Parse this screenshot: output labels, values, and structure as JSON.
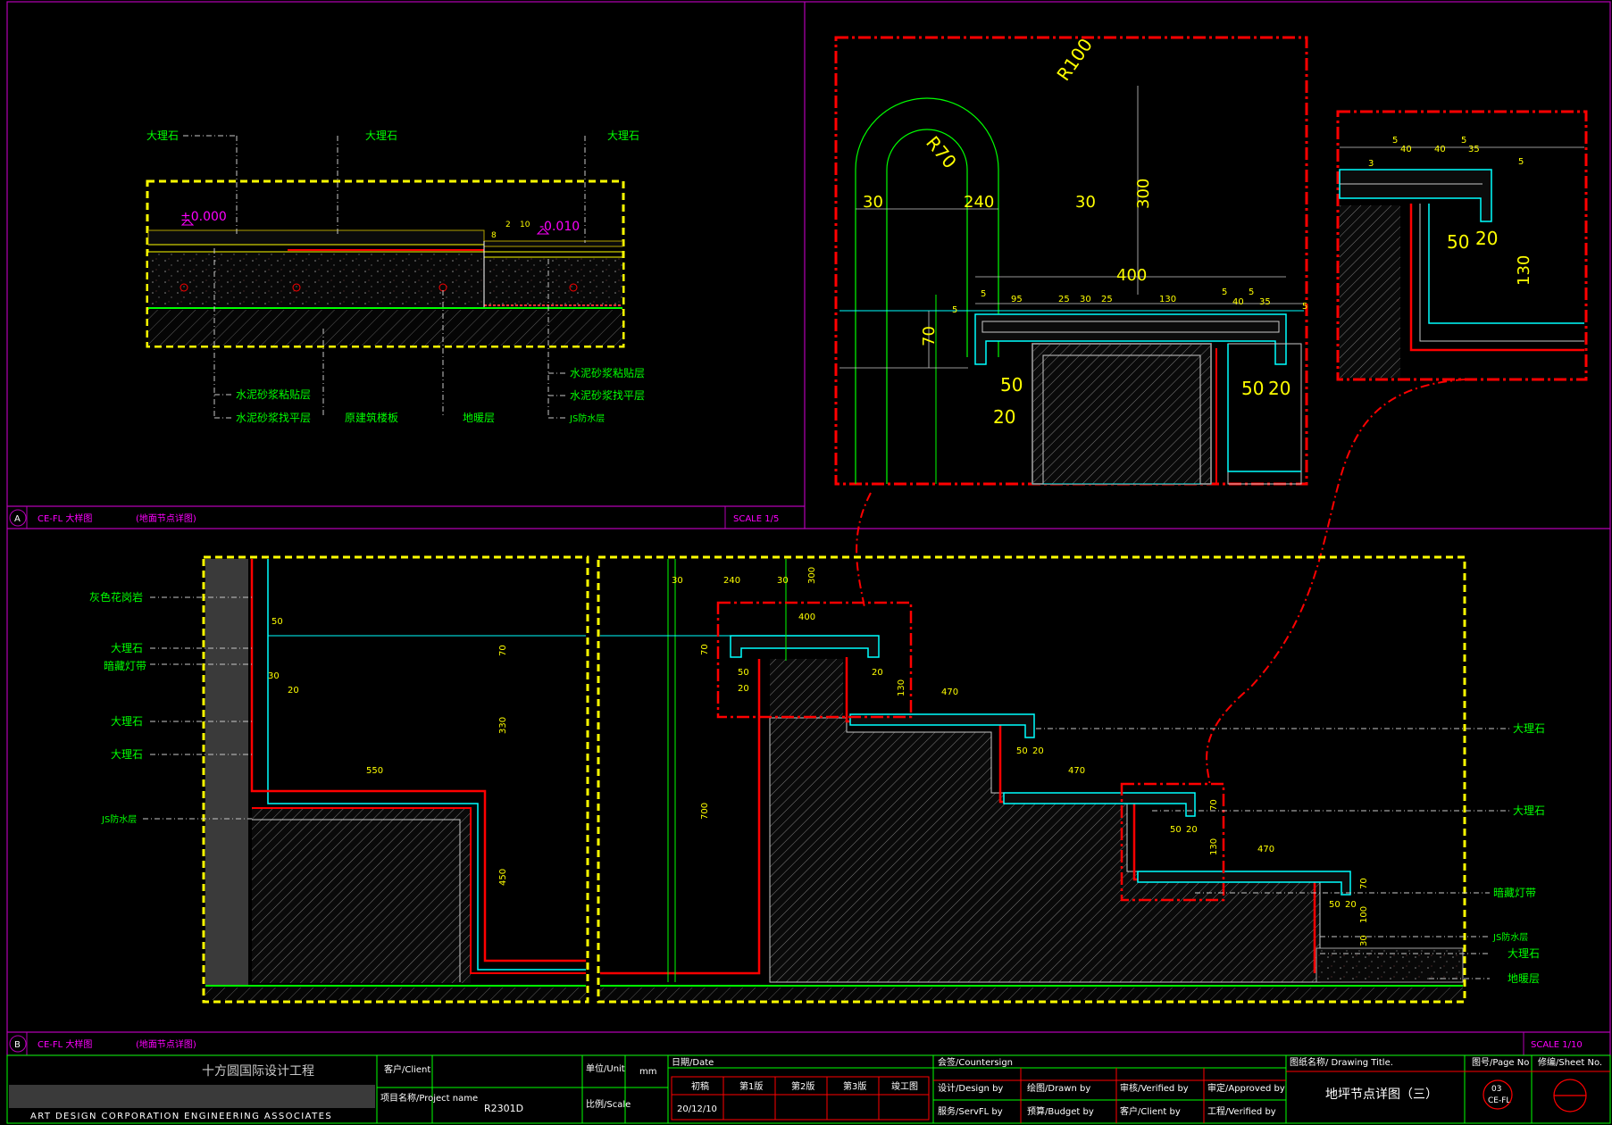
{
  "detail_a": {
    "labels_top": [
      "大理石",
      "大理石",
      "大理石"
    ],
    "level_left": "±0.000",
    "level_right": "-0.010",
    "dims": [
      "2",
      "10",
      "8"
    ],
    "labels_bottom_right": [
      "水泥砂浆粘贴层",
      "水泥砂浆找平层",
      "JS防水层"
    ],
    "labels_bottom": [
      "水泥砂浆粘贴层",
      "水泥砂浆找平层",
      "原建筑楼板",
      "地暖层"
    ],
    "title_bar": {
      "marker": "A",
      "code": "CE-FL 大样图",
      "name": "(地面节点详图)",
      "scale": "SCALE 1/5"
    }
  },
  "zoom_main": {
    "radius_outer": "R100",
    "radius_inner": "R70",
    "dims_top": [
      "30",
      "240",
      "30"
    ],
    "dim_height": "300",
    "dim_width": "400",
    "dims_row": [
      "5",
      "95",
      "25",
      "30",
      "25",
      "130",
      "5",
      "40",
      "5",
      "35",
      "5"
    ],
    "dim_70": "70",
    "dim_5": "5",
    "dims_light": [
      "50",
      "20",
      "50",
      "20"
    ]
  },
  "zoom_side": {
    "dims_row": [
      "5",
      "40",
      "40",
      "5",
      "35",
      "5"
    ],
    "dim_3": "3",
    "dims_light": [
      "50",
      "20"
    ],
    "dim_height": "130"
  },
  "detail_b": {
    "labels_left": [
      "灰色花岗岩",
      "大理石",
      "暗藏灯带",
      "大理石",
      "大理石",
      "JS防水层"
    ],
    "labels_right": [
      "大理石",
      "大理石",
      "暗藏灯带",
      "JS防水层",
      "大理石",
      "地暖层"
    ],
    "dims_left": [
      "50",
      "70",
      "30",
      "20",
      "330",
      "550",
      "450"
    ],
    "dims_main": [
      "30",
      "240",
      "30",
      "300",
      "400",
      "70",
      "50",
      "20",
      "20",
      "130",
      "700",
      "470",
      "50",
      "20",
      "470",
      "70",
      "50",
      "20",
      "130",
      "470",
      "70",
      "50",
      "20",
      "100",
      "30"
    ],
    "title_bar": {
      "marker": "B",
      "code": "CE-FL 大样图",
      "name": "(地面节点详图)",
      "scale": "SCALE 1/10"
    }
  },
  "title_block": {
    "company_cn": "十方圆国际设计工程",
    "company_en": "ART DESIGN CORPORATION ENGINEERING ASSOCIATES",
    "client_label": "客户/Client",
    "project_label": "项目名称/Project name",
    "project_value": "R2301D",
    "unit_label": "单位/Unit",
    "unit_value": "mm",
    "scale_label": "比例/Scale",
    "date_label": "日期/Date",
    "stages": [
      "初稿",
      "第1版",
      "第2版",
      "第3版",
      "竣工图"
    ],
    "date_value": "20/12/10",
    "countersign_label": "会签/Countersign",
    "design_by": "设计/Design by",
    "drawn_by": "绘图/Drawn by",
    "verified_by": "审核/Verified by",
    "approved_by": "审定/Approved by",
    "service_by": "服务/ServFL by",
    "budget_by": "预算/Budget by",
    "client_by": "客户/Client by",
    "verified_by2": "工程/Verified by",
    "drawing_title_label": "图纸名称/  Drawing Title.",
    "drawing_title": "地坪节点详图（三）",
    "page_no_label": "图号/Page No",
    "page_no": "03",
    "page_code": "CE-FL",
    "sheet_label": "修编/Sheet No."
  },
  "colors": {
    "frame": "#b400b4",
    "detail_box": "#ffff00",
    "callout": "#ff0000",
    "label": "#00ff00",
    "dim": "#ffff00",
    "surface": "#00ffff",
    "hatch": "#9a9a9a"
  }
}
